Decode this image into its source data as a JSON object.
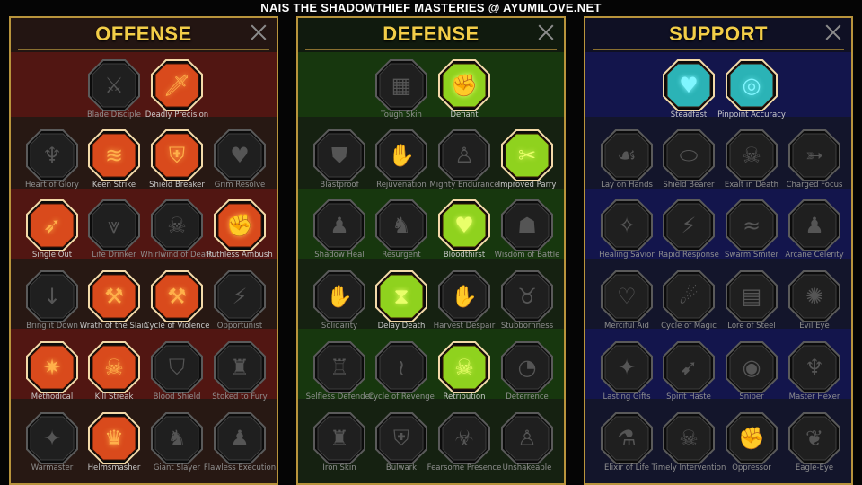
{
  "title": "NAIS THE SHADOWTHIEF MASTERIES @ AYUMILOVE.NET",
  "colors": {
    "offense_active": "#d94a1c",
    "defense_active": "#8fd21e",
    "support_active": "#2bb3b6",
    "inactive": "#1f1f1f",
    "title_gold": "#f2cd48"
  },
  "panels": [
    {
      "key": "offense",
      "title": "OFFENSE",
      "rows": [
        [
          {
            "name": "Blade Disciple",
            "icon": "crossed-swords-icon",
            "active": false
          },
          {
            "name": "Deadly Precision",
            "icon": "dagger-icon",
            "active": true
          }
        ],
        [
          {
            "name": "Heart of Glory",
            "icon": "heart-horns-icon",
            "active": false
          },
          {
            "name": "Keen Strike",
            "icon": "slash-strike-icon",
            "active": true
          },
          {
            "name": "Shield Breaker",
            "icon": "broken-shield-icon",
            "active": true
          },
          {
            "name": "Grim Resolve",
            "icon": "wings-heart-icon",
            "active": false
          }
        ],
        [
          {
            "name": "Single Out",
            "icon": "target-arrows-icon",
            "active": true
          },
          {
            "name": "Life Drinker",
            "icon": "fangs-icon",
            "active": false
          },
          {
            "name": "Whirlwind of Death",
            "icon": "skull-swirl-icon",
            "active": false
          },
          {
            "name": "Ruthless Ambush",
            "icon": "fist-dagger-icon",
            "active": true
          }
        ],
        [
          {
            "name": "Bring it Down",
            "icon": "falling-blade-icon",
            "active": false
          },
          {
            "name": "Wrath of the Slain",
            "icon": "fist-hammer-icon",
            "active": true
          },
          {
            "name": "Cycle of Violence",
            "icon": "axe-icon",
            "active": true
          },
          {
            "name": "Opportunist",
            "icon": "chain-lightning-icon",
            "active": false
          }
        ],
        [
          {
            "name": "Methodical",
            "icon": "arrows-burst-icon",
            "active": true
          },
          {
            "name": "Kill Streak",
            "icon": "skull-bones-icon",
            "active": true
          },
          {
            "name": "Blood Shield",
            "icon": "blade-shield-icon",
            "active": false
          },
          {
            "name": "Stoked to Fury",
            "icon": "angry-figure-icon",
            "active": false
          }
        ],
        [
          {
            "name": "Warmaster",
            "icon": "sword-sparkle-icon",
            "active": false
          },
          {
            "name": "Helmsmasher",
            "icon": "helmet-icon",
            "active": true
          },
          {
            "name": "Giant Slayer",
            "icon": "giant-icon",
            "active": false
          },
          {
            "name": "Flawless Execution",
            "icon": "executioner-icon",
            "active": false
          }
        ]
      ]
    },
    {
      "key": "defense",
      "title": "DEFENSE",
      "rows": [
        [
          {
            "name": "Tough Skin",
            "icon": "scales-armor-icon",
            "active": false
          },
          {
            "name": "Defiant",
            "icon": "raised-fist-icon",
            "active": true
          }
        ],
        [
          {
            "name": "Blastproof",
            "icon": "chest-armor-icon",
            "active": false
          },
          {
            "name": "Rejuvenation",
            "icon": "hand-drop-icon",
            "active": false
          },
          {
            "name": "Mighty Endurance",
            "icon": "muscle-man-icon",
            "active": false
          },
          {
            "name": "Improved Parry",
            "icon": "crossed-blades-icon",
            "active": true
          }
        ],
        [
          {
            "name": "Shadow Heal",
            "icon": "shadow-figure-icon",
            "active": false
          },
          {
            "name": "Resurgent",
            "icon": "knight-icon",
            "active": false
          },
          {
            "name": "Bloodthirst",
            "icon": "heart-skull-icon",
            "active": true
          },
          {
            "name": "Wisdom of Battle",
            "icon": "hooded-face-icon",
            "active": false
          }
        ],
        [
          {
            "name": "Solidarity",
            "icon": "raised-hands-icon",
            "active": false
          },
          {
            "name": "Delay Death",
            "icon": "hourglass-icon",
            "active": true
          },
          {
            "name": "Harvest Despair",
            "icon": "open-hand-icon",
            "active": false
          },
          {
            "name": "Stubbornness",
            "icon": "bull-icon",
            "active": false
          }
        ],
        [
          {
            "name": "Selfless Defender",
            "icon": "running-figure-icon",
            "active": false
          },
          {
            "name": "Cycle of Revenge",
            "icon": "claw-marks-icon",
            "active": false
          },
          {
            "name": "Retribution",
            "icon": "glowing-skull-icon",
            "active": true
          },
          {
            "name": "Deterrence",
            "icon": "spinning-blade-icon",
            "active": false
          }
        ],
        [
          {
            "name": "Iron Skin",
            "icon": "armored-warrior-icon",
            "active": false
          },
          {
            "name": "Bulwark",
            "icon": "tower-shield-icon",
            "active": false
          },
          {
            "name": "Fearsome Presence",
            "icon": "demon-face-icon",
            "active": false
          },
          {
            "name": "Unshakeable",
            "icon": "strongman-icon",
            "active": false
          }
        ]
      ]
    },
    {
      "key": "support",
      "title": "SUPPORT",
      "rows": [
        [
          {
            "name": "Steadfast",
            "icon": "hand-heart-icon",
            "active": true
          },
          {
            "name": "Pinpoint Accuracy",
            "icon": "bullseye-icon",
            "active": true
          }
        ],
        [
          {
            "name": "Lay on Hands",
            "icon": "praying-hands-icon",
            "active": false
          },
          {
            "name": "Shield Bearer",
            "icon": "round-shield-icon",
            "active": false
          },
          {
            "name": "Exalt in Death",
            "icon": "flaming-skull-icon",
            "active": false
          },
          {
            "name": "Charged Focus",
            "icon": "beam-hand-icon",
            "active": false
          }
        ],
        [
          {
            "name": "Healing Savior",
            "icon": "sparkle-figure-icon",
            "active": false
          },
          {
            "name": "Rapid Response",
            "icon": "lightning-icon",
            "active": false
          },
          {
            "name": "Swarm Smiter",
            "icon": "swarm-icon",
            "active": false
          },
          {
            "name": "Arcane Celerity",
            "icon": "dual-figure-icon",
            "active": false
          }
        ],
        [
          {
            "name": "Merciful Aid",
            "icon": "chained-heart-icon",
            "active": false
          },
          {
            "name": "Cycle of Magic",
            "icon": "comet-icon",
            "active": false
          },
          {
            "name": "Lore of Steel",
            "icon": "open-book-icon",
            "active": false
          },
          {
            "name": "Evil Eye",
            "icon": "evil-eye-burst-icon",
            "active": false
          }
        ],
        [
          {
            "name": "Lasting Gifts",
            "icon": "compass-star-icon",
            "active": false
          },
          {
            "name": "Spirit Haste",
            "icon": "winged-boot-icon",
            "active": false
          },
          {
            "name": "Sniper",
            "icon": "eye-icon",
            "active": false
          },
          {
            "name": "Master Hexer",
            "icon": "hexer-figure-icon",
            "active": false
          }
        ],
        [
          {
            "name": "Elixir of Life",
            "icon": "potion-icon",
            "active": false
          },
          {
            "name": "Timely Intervention",
            "icon": "skull-helm-icon",
            "active": false
          },
          {
            "name": "Oppressor",
            "icon": "crushing-fist-icon",
            "active": false
          },
          {
            "name": "Eagle-Eye",
            "icon": "eagle-icon",
            "active": false
          }
        ]
      ]
    }
  ]
}
